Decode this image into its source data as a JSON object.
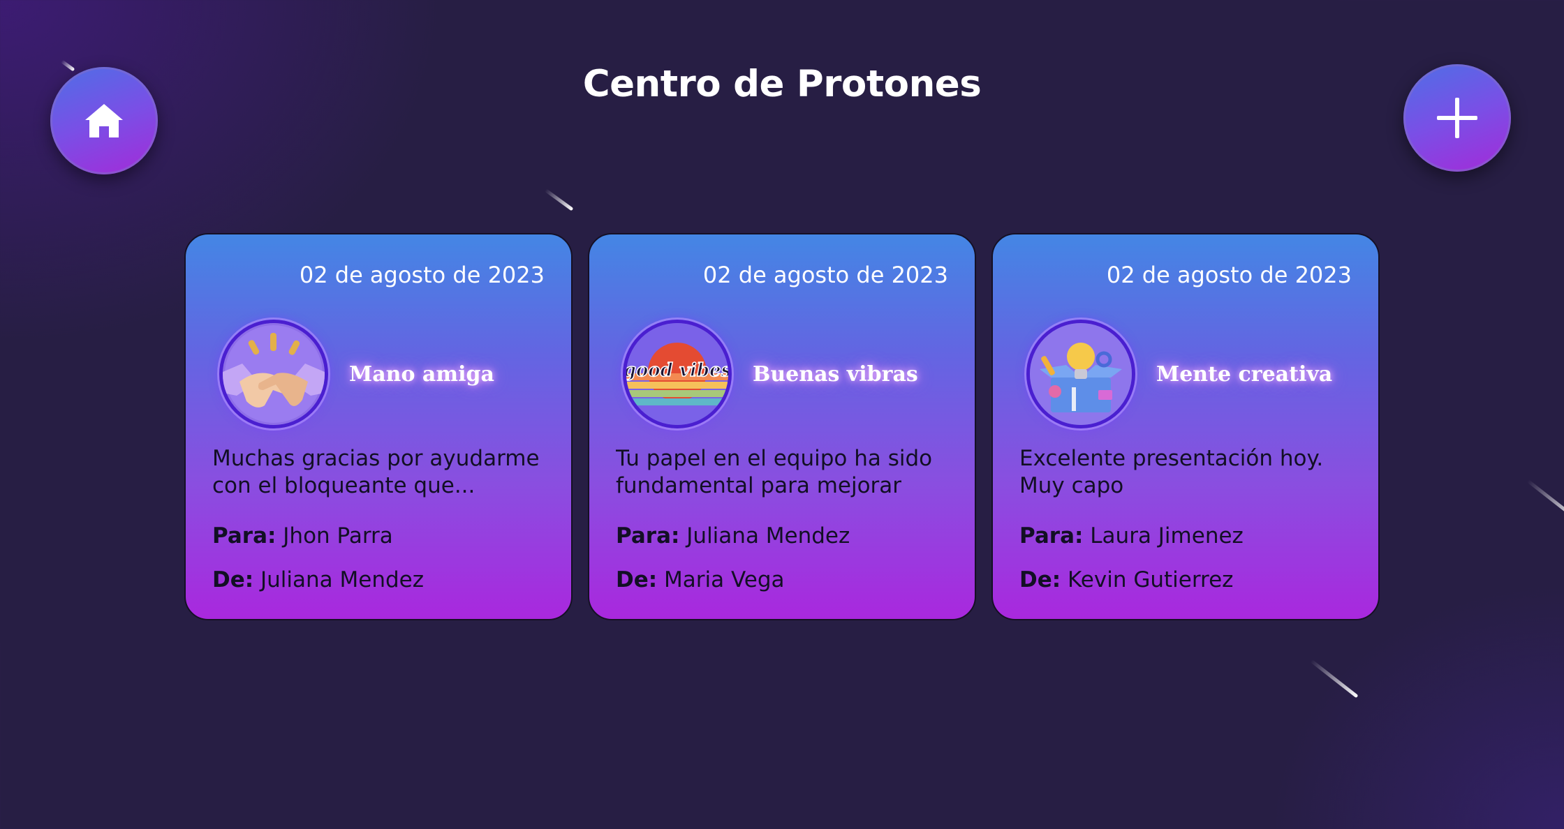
{
  "header": {
    "title": "Centro de Protones"
  },
  "actions": {
    "home_icon": "home-icon",
    "add_icon": "plus-icon"
  },
  "cards": [
    {
      "date": "02 de agosto de 2023",
      "badge_name": "Mano amiga",
      "badge_icon": "handshake-icon",
      "message": "Muchas gracias por ayudarme con el bloqueante que...",
      "to_label": "Para:",
      "to": "Jhon Parra",
      "from_label": "De:",
      "from": "Juliana Mendez"
    },
    {
      "date": "02 de agosto de 2023",
      "badge_name": "Buenas vibras",
      "badge_icon": "good-vibes-icon",
      "badge_art_text": "good vibes",
      "message": "Tu papel en el equipo ha sido fundamental para mejorar el...",
      "to_label": "Para:",
      "to": "Juliana Mendez",
      "from_label": "De:",
      "from": "Maria Vega"
    },
    {
      "date": "02 de agosto de 2023",
      "badge_name": "Mente creativa",
      "badge_icon": "creative-mind-icon",
      "message": "Excelente presentación hoy. Muy capo",
      "to_label": "Para:",
      "to": "Laura Jimenez",
      "from_label": "De:",
      "from": "Kevin Gutierrez"
    }
  ],
  "colors": {
    "background": "#271e44",
    "card_top": "#4486e4",
    "card_bottom": "#a928de",
    "title": "#ffffff"
  }
}
